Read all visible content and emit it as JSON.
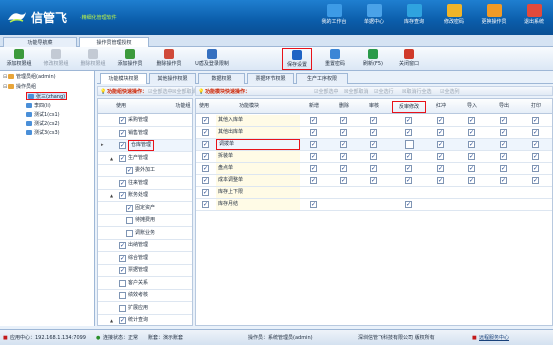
{
  "app": {
    "name": "信管飞",
    "subtitle": "·精细化管理软件",
    "colors": {
      "topbar": "#0b5daa",
      "highlight": "#e8131a",
      "accent": "#b9f04a"
    }
  },
  "topnav": [
    {
      "label": "我的工作台",
      "icon": "monitor-icon"
    },
    {
      "label": "单据中心",
      "icon": "documents-icon"
    },
    {
      "label": "库存查询",
      "icon": "magnifier-icon"
    },
    {
      "label": "修改密码",
      "icon": "lock-icon"
    },
    {
      "label": "更换操作员",
      "icon": "users-icon"
    },
    {
      "label": "退出系统",
      "icon": "exit-icon"
    }
  ],
  "page_tabs": [
    {
      "label": "功能导航菜"
    },
    {
      "label": "操作员管理授权",
      "active": true
    }
  ],
  "toolbar": [
    {
      "label": "添加权限组",
      "icon": "add-group-icon",
      "enabled": true
    },
    {
      "label": "修改权限组",
      "icon": "edit-group-icon",
      "enabled": false
    },
    {
      "label": "删除权限组",
      "icon": "delete-group-icon",
      "enabled": false
    },
    {
      "label": "添加操作员",
      "icon": "add-user-icon",
      "enabled": true
    },
    {
      "label": "删除操作员",
      "icon": "delete-user-icon",
      "enabled": true
    },
    {
      "label": "U盾及登录限制",
      "icon": "key-icon",
      "enabled": true
    },
    {
      "label": "保存设置",
      "icon": "save-icon",
      "enabled": true,
      "highlighted": true
    },
    {
      "label": "重置密码",
      "icon": "reset-password-icon",
      "enabled": true
    },
    {
      "label": "刷新(F5)",
      "icon": "refresh-icon",
      "enabled": true
    },
    {
      "label": "关闭窗口",
      "icon": "close-window-icon",
      "enabled": true
    }
  ],
  "tree": {
    "nodes": [
      {
        "label": "管理员组(admin)",
        "level": 1
      },
      {
        "label": "操作员组",
        "level": 1
      },
      {
        "label": "张三(zhang)",
        "level": 2,
        "selected": true
      },
      {
        "label": "李四(li)",
        "level": 2
      },
      {
        "label": "测试1(cs1)",
        "level": 2
      },
      {
        "label": "测试2(cs2)",
        "level": 2
      },
      {
        "label": "测试3(cs3)",
        "level": 2
      }
    ]
  },
  "subtabs": [
    {
      "label": "功能模块权限",
      "active": true
    },
    {
      "label": "其他操作权限"
    },
    {
      "label": "数据权限"
    },
    {
      "label": "票据环节权限"
    },
    {
      "label": "生产工序权限"
    }
  ],
  "quick_left": {
    "title": "功能组快速操作：",
    "select_all": "全部选中",
    "cancel_all": "全部取消"
  },
  "quick_right": {
    "title": "功能模块快速操作：",
    "select_all": "全部选中",
    "cancel_all": "全部取消",
    "select_row": "全选行",
    "cancel_row": "取消行全选",
    "select_col": "全选列"
  },
  "groups": {
    "headers": [
      "使用",
      "功能组"
    ],
    "rows": [
      {
        "label": "采购管理",
        "checked": true
      },
      {
        "label": "销售管理",
        "checked": true
      },
      {
        "label": "仓库管理",
        "checked": true,
        "current": true,
        "highlighted": true
      },
      {
        "label": "生产管理",
        "checked": true,
        "toggle": "▲"
      },
      {
        "label": "委外加工",
        "checked": true,
        "indent": true
      },
      {
        "label": "往来管理",
        "checked": true
      },
      {
        "label": "账务处理",
        "checked": true,
        "toggle": "▲"
      },
      {
        "label": "固定资产",
        "checked": true,
        "indent": true
      },
      {
        "label": "待摊费用",
        "checked": false,
        "indent": true
      },
      {
        "label": "调账业务",
        "checked": false,
        "indent": true
      },
      {
        "label": "出纳管理",
        "checked": true
      },
      {
        "label": "综合管理",
        "checked": true
      },
      {
        "label": "票据管理",
        "checked": true
      },
      {
        "label": "客户关系",
        "checked": false
      },
      {
        "label": "绩效考核",
        "checked": false
      },
      {
        "label": "扩展应用",
        "checked": false
      },
      {
        "label": "统计查询",
        "checked": true,
        "toggle": "▲"
      }
    ]
  },
  "modules": {
    "headers": [
      "使用",
      "功能模块",
      "新增",
      "删除",
      "审核",
      "反审修改",
      "红冲",
      "导入",
      "导出",
      "打印"
    ],
    "rows": [
      {
        "label": "其他入库单",
        "use": true,
        "perms": [
          true,
          true,
          true,
          true,
          true,
          true,
          true,
          true
        ]
      },
      {
        "label": "其他出库单",
        "use": true,
        "perms": [
          true,
          true,
          true,
          true,
          true,
          true,
          true,
          true
        ]
      },
      {
        "label": "调拨单",
        "use": true,
        "current": true,
        "highlighted": true,
        "perms": [
          true,
          true,
          true,
          false,
          true,
          true,
          true,
          true
        ]
      },
      {
        "label": "拆装单",
        "use": true,
        "perms": [
          true,
          true,
          true,
          true,
          true,
          true,
          true,
          true
        ]
      },
      {
        "label": "盘点单",
        "use": true,
        "perms": [
          true,
          true,
          true,
          true,
          true,
          true,
          true,
          true
        ]
      },
      {
        "label": "成本调整单",
        "use": true,
        "perms": [
          true,
          true,
          true,
          true,
          true,
          true,
          true,
          true
        ]
      },
      {
        "label": "库存上下限",
        "use": true,
        "perms": [
          null,
          null,
          null,
          null,
          null,
          null,
          null,
          null
        ]
      },
      {
        "label": "库存月结",
        "use": true,
        "perms": [
          true,
          null,
          null,
          true,
          null,
          null,
          null,
          null
        ]
      }
    ]
  },
  "status": {
    "center": "应用中心：192.168.1.134:7099",
    "connection": "连接状态：正常",
    "account": "账套：演示账套",
    "operator": "操作员：系统管理员(admin)",
    "company": "深圳信管飞科技有限公司 版权所有",
    "support": "远程服务中心"
  }
}
